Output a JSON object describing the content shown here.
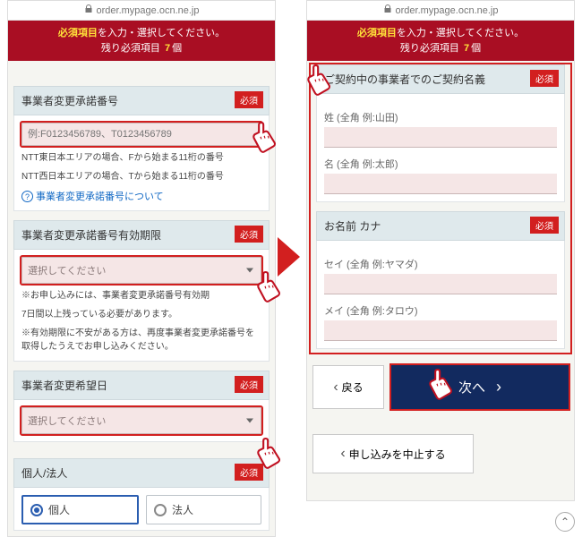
{
  "url": "order.mypage.ocn.ne.jp",
  "banner": {
    "required_label": "必須項目",
    "line1_rest": "を入力・選択してください。",
    "line2_pre": "残り必須項目",
    "count": "7",
    "line2_suf": "個"
  },
  "required_badge": "必須",
  "left": {
    "s1": {
      "title": "事業者変更承諾番号",
      "placeholder": "例:F0123456789、T0123456789",
      "note1": "NTT東日本エリアの場合、Fから始まる11桁の番号",
      "note2": "NTT西日本エリアの場合、Tから始まる11桁の番号",
      "help_link": "事業者変更承諾番号について"
    },
    "s2": {
      "title": "事業者変更承諾番号有効期限",
      "select_ph": "選択してください",
      "note1": "※お申し込みには、事業者変更承諾番号有効期",
      "note2": "7日間以上残っている必要があります。",
      "note3": "※有効期限に不安がある方は、再度事業者変更承諾番号を取得したうえでお申し込みください。"
    },
    "s3": {
      "title": "事業者変更希望日",
      "select_ph": "選択してください"
    },
    "s4": {
      "title": "個人/法人",
      "opt_personal": "個人",
      "opt_corp": "法人"
    }
  },
  "right": {
    "s1": {
      "title": "ご契約中の事業者でのご契約名義",
      "surname_ph": "姓 (全角 例:山田)",
      "given_ph": "名 (全角 例:太郎)"
    },
    "s2": {
      "title": "お名前 カナ",
      "sei_ph": "セイ (全角 例:ヤマダ)",
      "mei_ph": "メイ (全角 例:タロウ)"
    },
    "back_label": "戻る",
    "next_label": "次へ",
    "cancel_label": "申し込みを中止する"
  }
}
